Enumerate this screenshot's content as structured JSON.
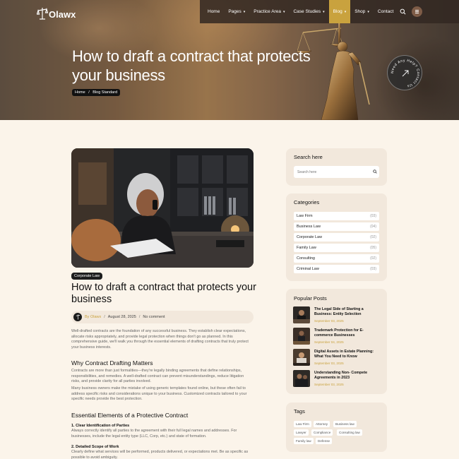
{
  "brand": {
    "name": "Olawx"
  },
  "nav": {
    "items": [
      {
        "label": "Home",
        "dropdown": false,
        "active": false
      },
      {
        "label": "Pages",
        "dropdown": true,
        "active": false
      },
      {
        "label": "Practice Area",
        "dropdown": true,
        "active": false
      },
      {
        "label": "Case Studies",
        "dropdown": true,
        "active": false
      },
      {
        "label": "Blog",
        "dropdown": true,
        "active": true
      },
      {
        "label": "Shop",
        "dropdown": true,
        "active": false
      },
      {
        "label": "Contact",
        "dropdown": false,
        "active": false
      }
    ],
    "search_icon": "search-icon",
    "menu_icon": "hamburger-icon"
  },
  "hero": {
    "title": "How to draft a contract that protects your business",
    "breadcrumb": [
      "Home",
      "Blog Standard"
    ],
    "badge_text": "Need Any Help? Contact Us"
  },
  "post": {
    "category": "Corporate Law",
    "title": "How to draft a contract that protects your business",
    "author": "By Olawx",
    "date": "August 28, 2025",
    "comments": "No comment",
    "intro": "Well-drafted contracts are the foundation of any successful business. They establish clear expectations, allocate risks appropriately, and provide legal protection when things don't go as planned. In this comprehensive guide, we'll walk you through the essential elements of drafting contracts that truly protect your business interests.",
    "section1_heading": "Why Contract Drafting Matters",
    "section1_p1": "Contracts are more than just formalities—they're legally binding agreements that define relationships, responsibilities, and remedies. A well-drafted contract can prevent misunderstandings, reduce litigation risks, and provide clarity for all parties involved.",
    "section1_p2": "Many business owners make the mistake of using generic templates found online, but these often fail to address specific risks and considerations unique to your business. Customized contracts tailored to your specific needs provide the best protection.",
    "section2_heading": "Essential Elements of a Protective Contract",
    "item1_heading": "1. Clear Identification of Parties",
    "item1_text": "Always correctly identify all parties to the agreement with their full legal names and addresses. For businesses, include the legal entity type (LLC, Corp, etc.) and state of formation.",
    "item2_heading": "2. Detailed Scope of Work",
    "item2_text": "Clearly define what services will be performed, products delivered, or expectations met. Be as specific as possible to avoid ambiguity."
  },
  "sidebar": {
    "search": {
      "title": "Search here",
      "placeholder": "Search here"
    },
    "categories": {
      "title": "Categories",
      "items": [
        {
          "name": "Law Firm",
          "count": "(03)"
        },
        {
          "name": "Business Law",
          "count": "(04)"
        },
        {
          "name": "Corporate Law",
          "count": "(02)"
        },
        {
          "name": "Family Law",
          "count": "(05)"
        },
        {
          "name": "Consulting",
          "count": "(02)"
        },
        {
          "name": "Criminal Law",
          "count": "(03)"
        }
      ]
    },
    "popular": {
      "title": "Popular Posts",
      "items": [
        {
          "title": "The Legal Side of Starting a Business: Entity Selection",
          "date": "September 03, 2025"
        },
        {
          "title": "Trademark Protection for E-commerce Businesses",
          "date": "September 04, 2025"
        },
        {
          "title": "Digital Assets in Estate Planning: What You Need to Know",
          "date": "September 03, 2025"
        },
        {
          "title": "Understanding Non- Compete Agreements in 2023",
          "date": "September 03, 2025"
        }
      ]
    },
    "tags": {
      "title": "Tags",
      "items": [
        "Law Firm",
        "Attorney",
        "Business law",
        "Lawyer",
        "Compliance",
        "Consulting law",
        "Family law",
        "Defense"
      ]
    }
  },
  "colors": {
    "accent": "#c9a23e",
    "background": "#fbf4ea",
    "card": "#f2e8dc",
    "dark": "#1d1d1d"
  }
}
